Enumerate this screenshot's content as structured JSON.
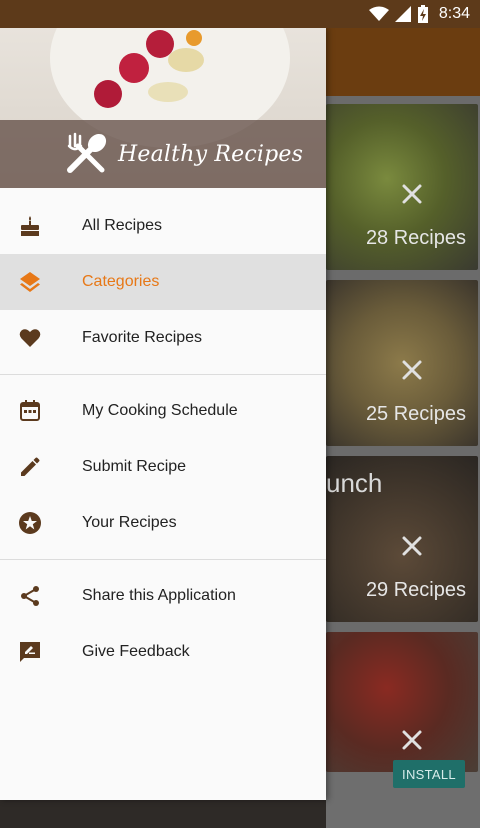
{
  "status_bar": {
    "time": "8:34"
  },
  "drawer": {
    "brand_title": "Healthy Recipes",
    "sections": [
      [
        {
          "label": "All Recipes",
          "icon": "cake-icon",
          "active": false
        },
        {
          "label": "Categories",
          "icon": "layers-icon",
          "active": true
        },
        {
          "label": "Favorite Recipes",
          "icon": "heart-icon",
          "active": false
        }
      ],
      [
        {
          "label": "My Cooking Schedule",
          "icon": "calendar-icon",
          "active": false
        },
        {
          "label": "Submit Recipe",
          "icon": "pencil-icon",
          "active": false
        },
        {
          "label": "Your Recipes",
          "icon": "star-badge-icon",
          "active": false
        }
      ],
      [
        {
          "label": "Share this Application",
          "icon": "share-icon",
          "active": false
        },
        {
          "label": "Give Feedback",
          "icon": "feedback-icon",
          "active": false
        }
      ]
    ]
  },
  "background": {
    "cards": [
      {
        "count": "28 Recipes"
      },
      {
        "count": "25 Recipes"
      },
      {
        "count": "29 Recipes",
        "title_partial": "unch"
      }
    ],
    "install_label": "INSTALL"
  },
  "colors": {
    "status_bar": "#5d3a1a",
    "toolbar": "#6b3d10",
    "icon_brown": "#5b3a1e",
    "accent_orange": "#e77817",
    "active_bg": "#e0e0e0",
    "install_button": "#1f6f69"
  }
}
